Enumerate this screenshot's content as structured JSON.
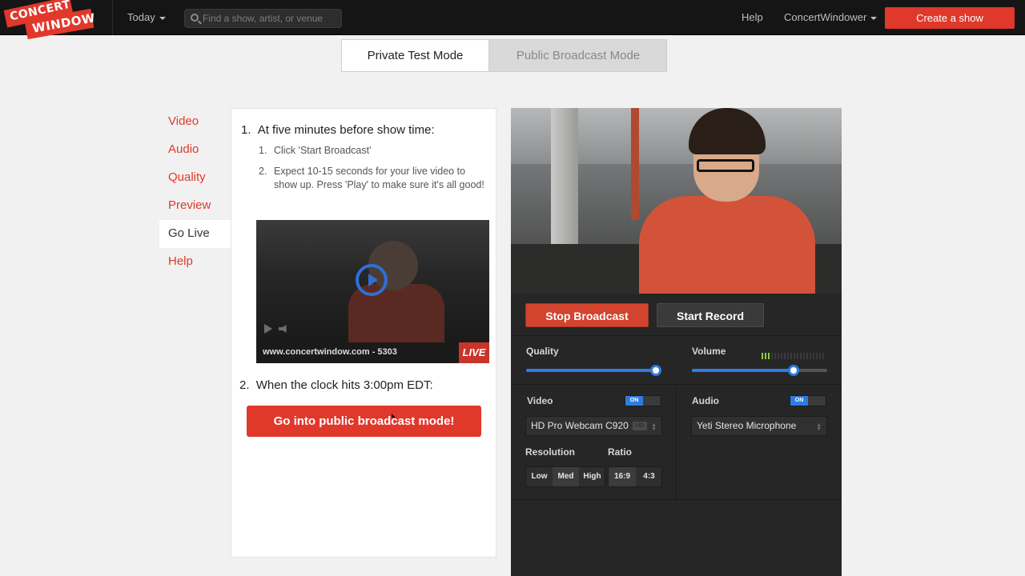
{
  "topbar": {
    "logo_line1": "CONCERT",
    "logo_line2": "WINDOW",
    "today": "Today",
    "search_placeholder": "Find a show, artist, or venue",
    "help": "Help",
    "user": "ConcertWindower",
    "create_button": "Create a show"
  },
  "modes": {
    "private": "Private Test Mode",
    "public": "Public Broadcast Mode"
  },
  "steps": [
    "Video",
    "Audio",
    "Quality",
    "Preview",
    "Go Live",
    "Help"
  ],
  "instructions": {
    "item1_num": "1.",
    "item1": "At five minutes before show time:",
    "sub1_num": "1.",
    "sub1": "Click 'Start Broadcast'",
    "sub2_num": "2.",
    "sub2": "Expect 10-15 seconds for your live video to show up. Press 'Play' to make sure it's all good!",
    "thumb_url": "www.concertwindow.com - 5303",
    "thumb_live": "LIVE",
    "item2_num": "2.",
    "item2": "When the clock hits 3:00pm EDT:",
    "cta": "Go into public broadcast mode!"
  },
  "broadcast": {
    "stop": "Stop Broadcast",
    "record": "Start Record",
    "quality_label": "Quality",
    "quality_level": 1.0,
    "volume_label": "Volume",
    "volume_level": 0.75,
    "video_label": "Video",
    "video_toggle": "ON",
    "video_device": "HD Pro Webcam C920",
    "hd_badge": "HD",
    "audio_label": "Audio",
    "audio_toggle": "ON",
    "audio_device": "Yeti Stereo Microphone",
    "resolution_label": "Resolution",
    "resolution_options": [
      "Low",
      "Med",
      "High"
    ],
    "resolution_selected": "Med",
    "ratio_label": "Ratio",
    "ratio_options": [
      "16:9",
      "4:3"
    ]
  },
  "colors": {
    "accent": "#e0382b",
    "slider": "#2f7de0",
    "meter": "#8fd13a"
  }
}
